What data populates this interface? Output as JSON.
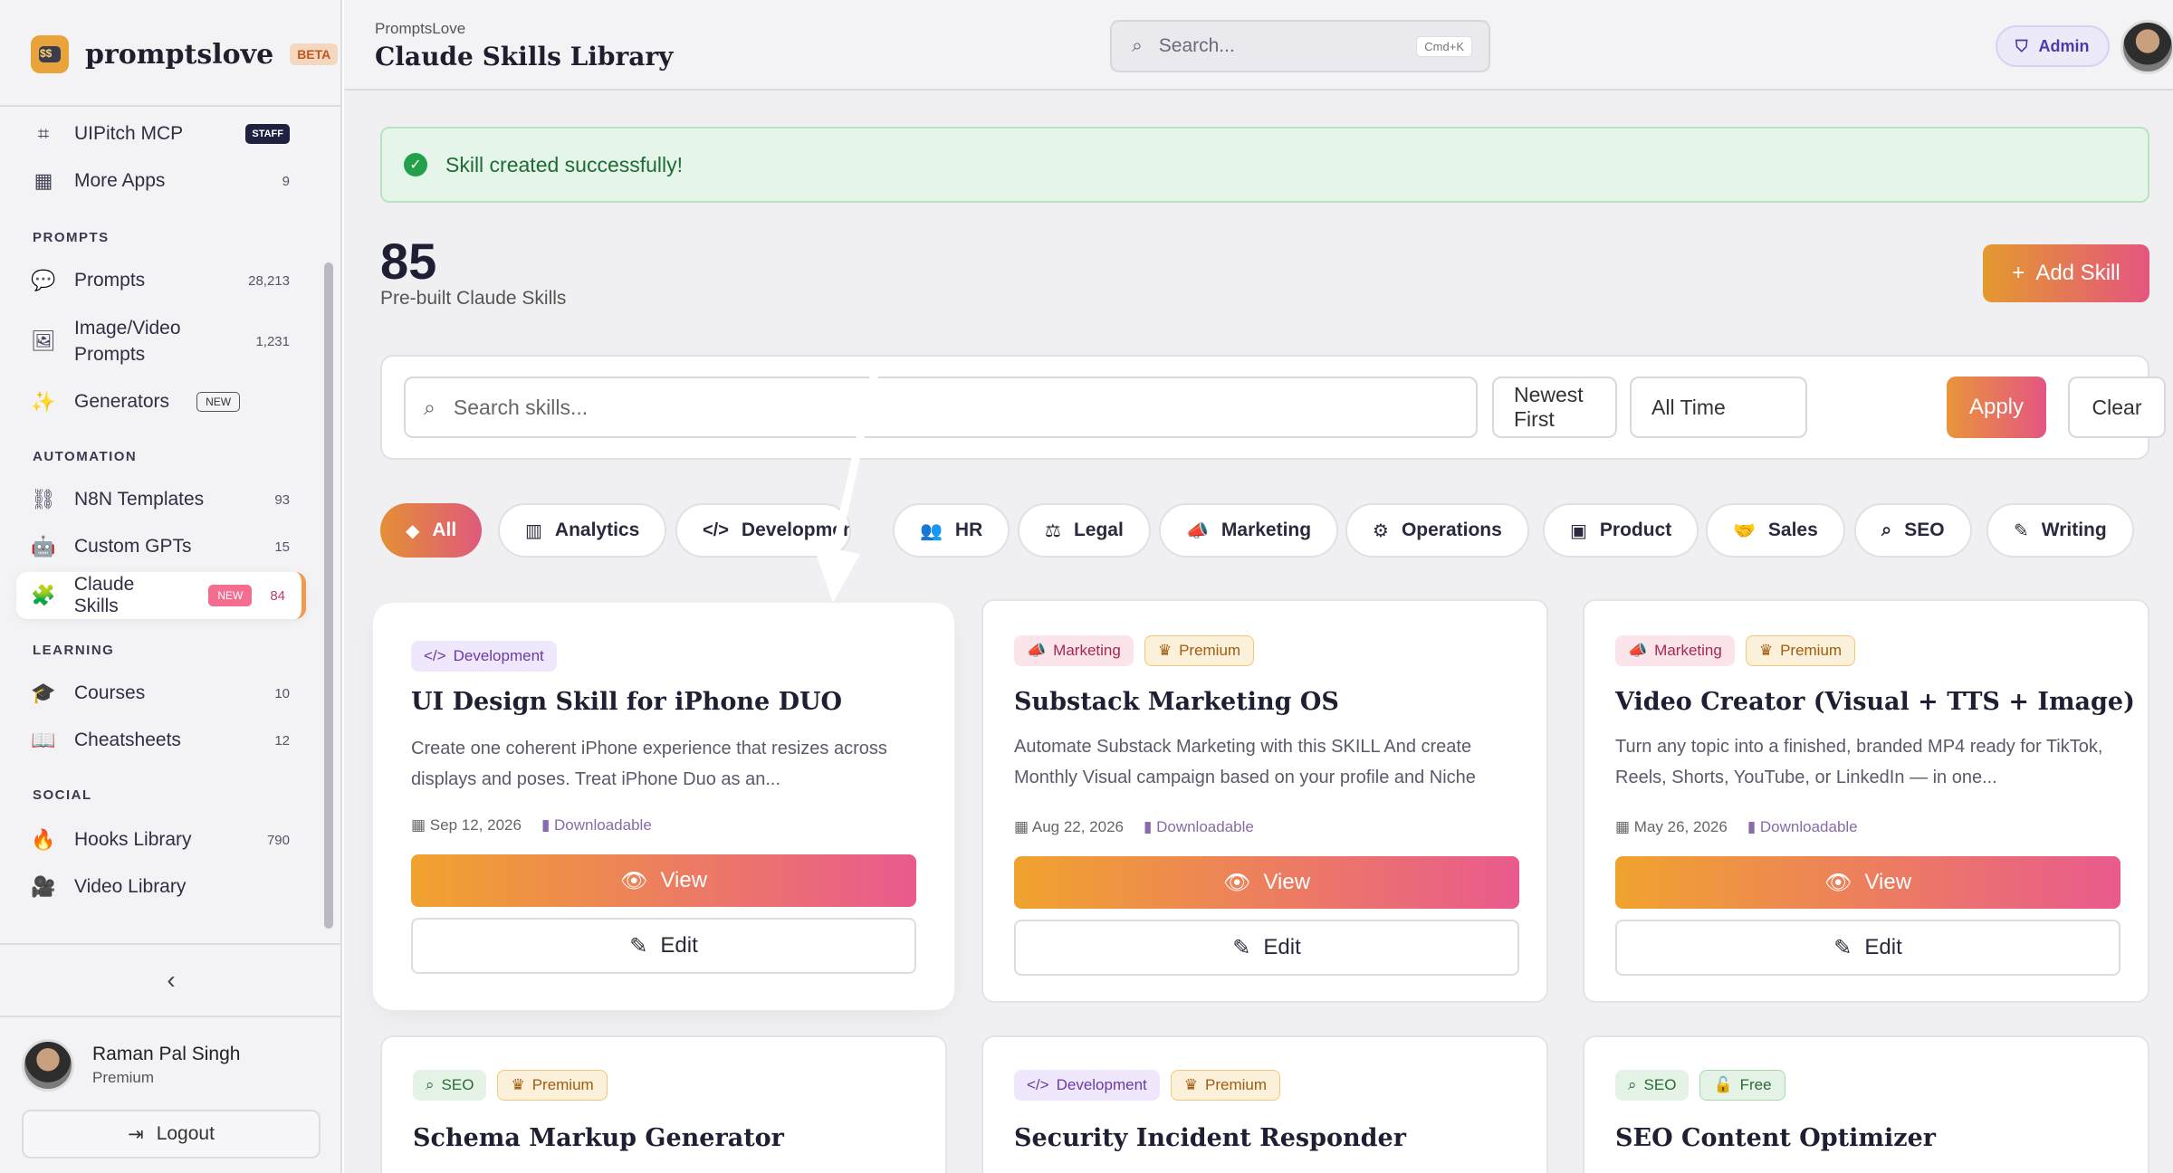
{
  "sidebar": {
    "brand": {
      "name": "promptslove",
      "badge": "BETA"
    },
    "items": [
      {
        "label": "UIPitch MCP",
        "badge": "STAFF",
        "icon": "frame-icon"
      },
      {
        "label": "More Apps",
        "count": "9",
        "icon": "grid-icon"
      }
    ],
    "sections": {
      "prompts": {
        "title": "PROMPTS",
        "items": [
          {
            "label": "Prompts",
            "count": "28,213",
            "icon": "chat-icon"
          },
          {
            "label_line1": "Image/Video",
            "label_line2": "Prompts",
            "count": "1,231",
            "icon": "image-icon"
          },
          {
            "label": "Generators",
            "badge": "NEW",
            "icon": "magic-wand-icon"
          }
        ]
      },
      "automation": {
        "title": "AUTOMATION",
        "items": [
          {
            "label": "N8N Templates",
            "count": "93",
            "icon": "workflow-icon"
          },
          {
            "label": "Custom GPTs",
            "count": "15",
            "icon": "robot-icon"
          },
          {
            "label": "Claude Skills",
            "badge": "NEW",
            "count": "84",
            "icon": "puzzle-icon",
            "active": true
          }
        ]
      },
      "learning": {
        "title": "LEARNING",
        "items": [
          {
            "label": "Courses",
            "count": "10",
            "icon": "graduation-cap-icon"
          },
          {
            "label": "Cheatsheets",
            "count": "12",
            "icon": "book-icon"
          }
        ]
      },
      "social": {
        "title": "SOCIAL",
        "items": [
          {
            "label": "Hooks Library",
            "count": "790",
            "icon": "fire-icon"
          },
          {
            "label": "Video Library",
            "count": "",
            "icon": "video-icon"
          }
        ]
      }
    },
    "user": {
      "name": "Raman Pal Singh",
      "plan": "Premium"
    },
    "logout_label": "Logout"
  },
  "header": {
    "breadcrumb": "PromptsLove",
    "title": "Claude Skills Library",
    "search_placeholder": "Search...",
    "shortcut": "Cmd+K",
    "admin_label": "Admin"
  },
  "main": {
    "toast": "Skill created successfully!",
    "stat": {
      "value": "85",
      "label": "Pre-built Claude Skills"
    },
    "add_button": "Add Skill",
    "filters": {
      "search_placeholder": "Search skills...",
      "sort": "Newest First",
      "time": "All Time",
      "apply": "Apply",
      "clear": "Clear"
    },
    "categories": [
      "All",
      "Analytics",
      "Development",
      "HR",
      "Legal",
      "Marketing",
      "Operations",
      "Product",
      "Sales",
      "SEO",
      "Writing"
    ],
    "cards": [
      {
        "tags": [
          "Development"
        ],
        "title": "UI Design Skill for iPhone DUO",
        "desc": "Create one coherent iPhone experience that resizes across displays and poses. Treat iPhone Duo as an...",
        "date": "Sep 12, 2026",
        "access": "Downloadable",
        "view": "View",
        "edit": "Edit"
      },
      {
        "tags": [
          "Marketing",
          "Premium"
        ],
        "title": "Substack Marketing OS",
        "desc": "Automate Substack Marketing with this SKILL And create Monthly Visual campaign based on your profile and Niche",
        "date": "Aug 22, 2026",
        "access": "Downloadable",
        "view": "View",
        "edit": "Edit"
      },
      {
        "tags": [
          "Marketing",
          "Premium"
        ],
        "title": "Video Creator (Visual + TTS + Image)",
        "desc": "Turn any topic into a finished, branded MP4 ready for TikTok, Reels, Shorts, YouTube, or LinkedIn — in one...",
        "date": "May 26, 2026",
        "access": "Downloadable",
        "view": "View",
        "edit": "Edit"
      },
      {
        "tags": [
          "SEO",
          "Premium"
        ],
        "title": "Schema Markup Generator"
      },
      {
        "tags": [
          "Development",
          "Premium"
        ],
        "title": "Security Incident Responder"
      },
      {
        "tags": [
          "SEO",
          "Free"
        ],
        "title": "SEO Content Optimizer"
      }
    ]
  },
  "colors": {
    "accent_start": "#f0a32e",
    "accent_end": "#e95a8e",
    "success": "#22a14a"
  }
}
